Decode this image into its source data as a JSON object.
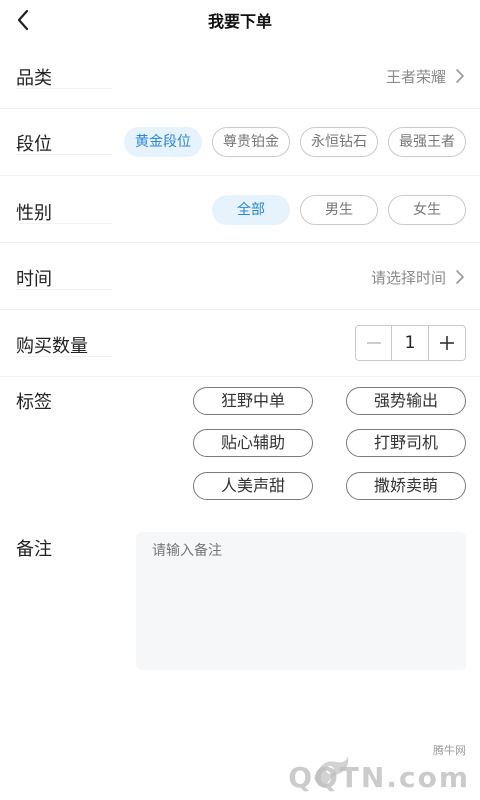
{
  "header": {
    "title": "我要下单",
    "back_icon": "chevron-left-icon"
  },
  "category": {
    "label": "品类",
    "value": "王者荣耀"
  },
  "rank": {
    "label": "段位",
    "options": [
      "黄金段位",
      "尊贵铂金",
      "永恒钻石",
      "最强王者"
    ],
    "selected": "黄金段位"
  },
  "gender": {
    "label": "性别",
    "options": [
      "全部",
      "男生",
      "女生"
    ],
    "selected": "全部"
  },
  "time": {
    "label": "时间",
    "placeholder": "请选择时间"
  },
  "quantity": {
    "label": "购买数量",
    "value": "1",
    "minus_icon": "minus-icon",
    "plus_icon": "plus-icon"
  },
  "tags": {
    "label": "标签",
    "items": [
      "狂野中单",
      "强势输出",
      "贴心辅助",
      "打野司机",
      "人美声甜",
      "撒娇卖萌"
    ]
  },
  "remark": {
    "label": "备注",
    "placeholder": "请输入备注"
  },
  "watermark": {
    "small_text": "腾牛网",
    "brand": "QQTN.com"
  },
  "colors": {
    "accent": "#2a86d6",
    "accent_bg": "#e6f2fc",
    "muted": "#8a8a8a"
  }
}
